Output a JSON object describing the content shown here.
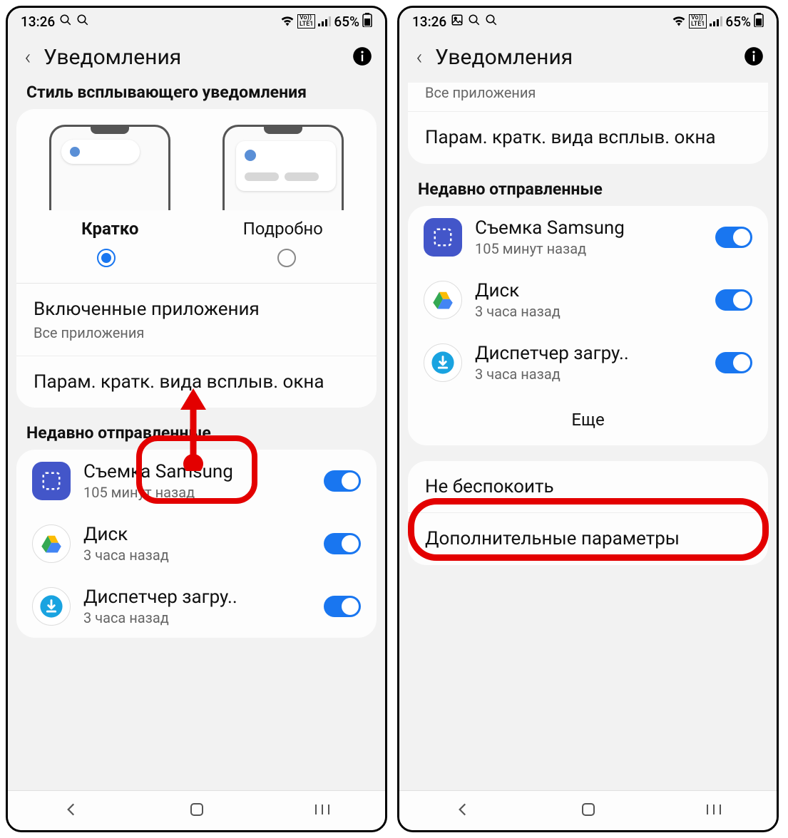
{
  "status": {
    "time": "13:26",
    "battery": "65%"
  },
  "header": {
    "title": "Уведомления"
  },
  "left": {
    "style_section": "Стиль всплывающего уведомления",
    "style_brief": "Кратко",
    "style_detailed": "Подробно",
    "included_apps_title": "Включенные приложения",
    "included_apps_sub": "Все приложения",
    "popup_params": "Парам. кратк. вида всплыв. окна",
    "recent_header": "Недавно отправленные",
    "apps": [
      {
        "name": "Съемка Samsung",
        "time": "105 минут назад"
      },
      {
        "name": "Диск",
        "time": "3 часа назад"
      },
      {
        "name": "Диспетчер загру..",
        "time": "3 часа назад"
      }
    ]
  },
  "right": {
    "all_apps": "Все приложения",
    "popup_params": "Парам. кратк. вида всплыв. окна",
    "recent_header": "Недавно отправленные",
    "apps": [
      {
        "name": "Съемка Samsung",
        "time": "105 минут назад"
      },
      {
        "name": "Диск",
        "time": "3 часа назад"
      },
      {
        "name": "Диспетчер загру..",
        "time": "3 часа назад"
      }
    ],
    "more": "Еще",
    "dnd": "Не беспокоить",
    "advanced": "Дополнительные параметры"
  }
}
